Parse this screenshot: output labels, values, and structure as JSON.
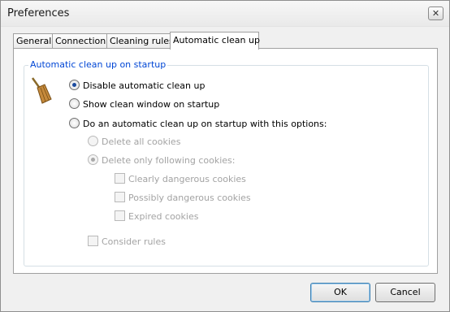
{
  "window": {
    "title": "Preferences"
  },
  "tabs": [
    {
      "label": "General"
    },
    {
      "label": "Connection"
    },
    {
      "label": "Cleaning rules"
    },
    {
      "label": "Automatic clean up",
      "active": true
    }
  ],
  "group": {
    "title": "Automatic clean up on startup",
    "options": {
      "disable": {
        "label": "Disable automatic clean up",
        "checked": true
      },
      "show_window": {
        "label": "Show clean window on startup",
        "checked": false
      },
      "auto": {
        "label": "Do an automatic clean up on startup with this options:",
        "checked": false
      },
      "delete_all": {
        "label": "Delete all cookies",
        "checked": false,
        "disabled": true
      },
      "delete_following": {
        "label": "Delete only following cookies:",
        "checked": true,
        "disabled": true
      },
      "clearly_dangerous": {
        "label": "Clearly dangerous cookies",
        "checked": false,
        "disabled": true
      },
      "possibly_dangerous": {
        "label": "Possibly dangerous cookies",
        "checked": false,
        "disabled": true
      },
      "expired": {
        "label": "Expired cookies",
        "checked": false,
        "disabled": true
      },
      "consider_rules": {
        "label": "Consider rules",
        "checked": false,
        "disabled": true
      }
    }
  },
  "buttons": {
    "ok": "OK",
    "cancel": "Cancel"
  }
}
